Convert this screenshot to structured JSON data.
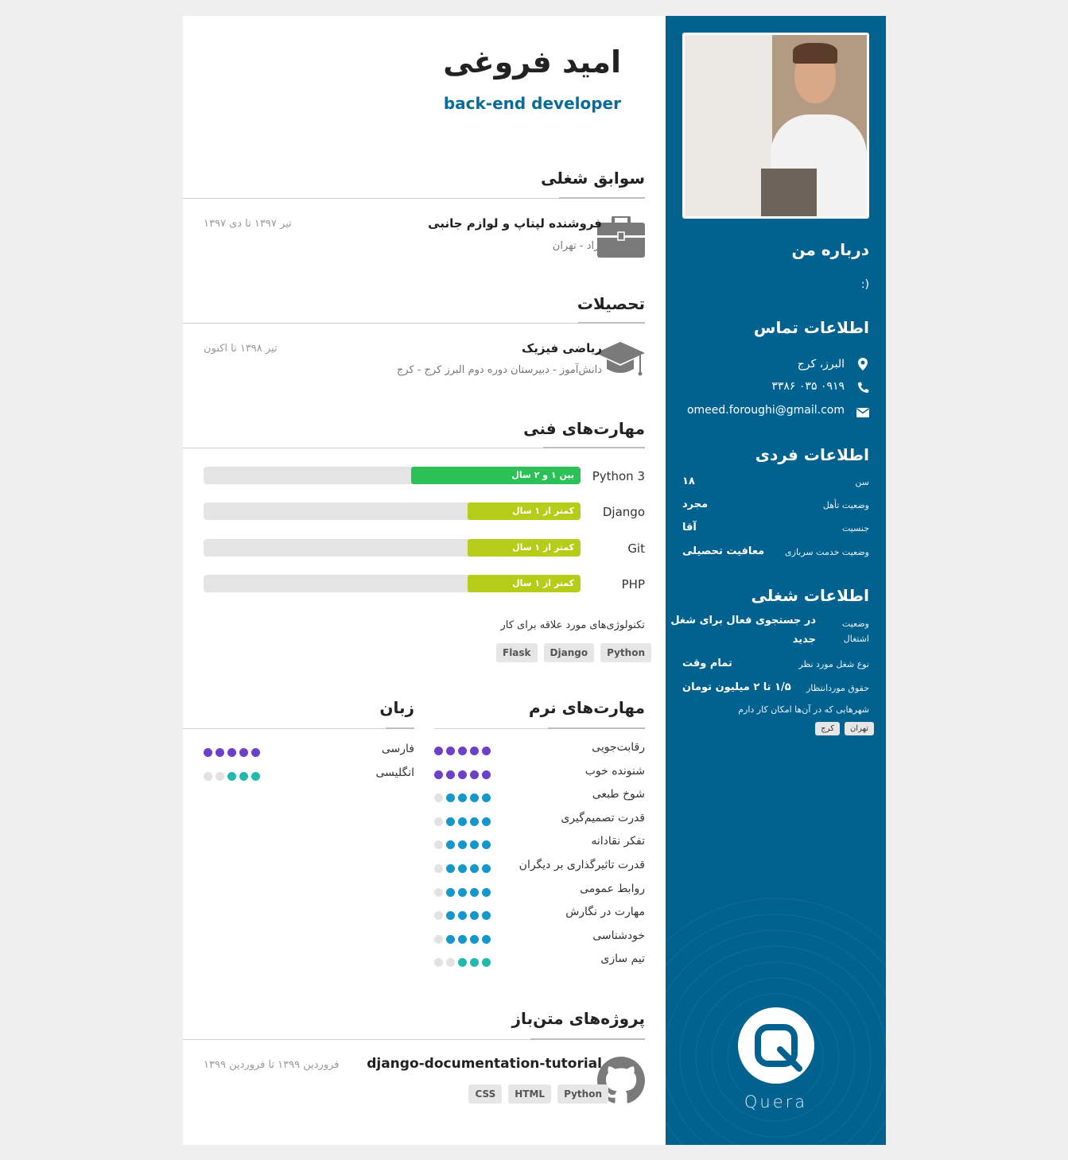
{
  "header": {
    "name": "امید فروغی",
    "role": "back-end developer"
  },
  "work": {
    "title": "سوابق شغلی",
    "items": [
      {
        "title": "فروشنده لپتاپ و لوازم جانبی",
        "sub": "آزاد - تهران",
        "date": "تیر ۱۳۹۷ تا دی ۱۳۹۷",
        "icon": "briefcase-icon"
      }
    ]
  },
  "education": {
    "title": "تحصیلات",
    "items": [
      {
        "title": "ریاضی فیزیک",
        "sub": "دانش‌آموز - دبیرستان دوره دوم البرز کرج - کرج",
        "date": "تیر ۱۳۹۸ تا اکنون",
        "icon": "graduation-cap-icon"
      }
    ]
  },
  "tech_skills": {
    "title": "مهارت‌های فنی",
    "skills": [
      {
        "name": "Python 3",
        "level": "بین ۱ و ۲ سال",
        "fraction": 0.45,
        "color": "#2bc157"
      },
      {
        "name": "Django",
        "level": "کمتر از ۱ سال",
        "fraction": 0.3,
        "color": "#b5cc18"
      },
      {
        "name": "Git",
        "level": "کمتر از ۱ سال",
        "fraction": 0.3,
        "color": "#b5cc18"
      },
      {
        "name": "PHP",
        "level": "کمتر از ۱ سال",
        "fraction": 0.3,
        "color": "#b5cc18"
      }
    ],
    "interest_label": "تکنولوژی‌های مورد علاقه برای کار",
    "interest_tags": [
      "Python",
      "Django",
      "Flask"
    ]
  },
  "soft_skills": {
    "title": "مهارت‌های نرم",
    "items": [
      {
        "label": "رقابت‌جویی",
        "level": 5
      },
      {
        "label": "شنونده خوب",
        "level": 5
      },
      {
        "label": "شوخ طبعی",
        "level": 4
      },
      {
        "label": "قدرت تصمیم‌گیری",
        "level": 4
      },
      {
        "label": "تفکر نقادانه",
        "level": 4
      },
      {
        "label": "قدرت تاثیرگذاری بر دیگران",
        "level": 4
      },
      {
        "label": "روابط عمومی",
        "level": 4
      },
      {
        "label": "مهارت در نگارش",
        "level": 4
      },
      {
        "label": "خودشناسی",
        "level": 4
      },
      {
        "label": "تیم سازی",
        "level": 3
      }
    ]
  },
  "languages": {
    "title": "زبان",
    "items": [
      {
        "label": "فارسی",
        "level": 5
      },
      {
        "label": "انگلیسی",
        "level": 3
      }
    ]
  },
  "projects": {
    "title": "پروژه‌های متن‌باز",
    "items": [
      {
        "title": "django-documentation-tutorial",
        "date": "فروردین ۱۳۹۹ تا فروردین ۱۳۹۹",
        "tags": [
          "Python",
          "HTML",
          "CSS"
        ],
        "icon": "github-icon"
      }
    ]
  },
  "colors": {
    "sidebar": "#02628f",
    "dot_purple": "#6e3fc8",
    "dot_blue": "#1597cc",
    "dot_teal": "#22b8b0",
    "bar_green": "#2bc157",
    "bar_lime": "#b5cc18"
  },
  "sidebar": {
    "about_title": "درباره من",
    "about_text": ":)",
    "contact_title": "اطلاعات تماس",
    "contact": {
      "location": "البرز، کرج",
      "phone": "۰۹۱۹ ۰۳۵ ۳۳۸۶",
      "email": "omeed.foroughi@gmail.com"
    },
    "personal_title": "اطلاعات فردی",
    "personal": [
      {
        "key": "سن",
        "value": "۱۸"
      },
      {
        "key": "وضعیت تأهل",
        "value": "مجرد"
      },
      {
        "key": "جنسیت",
        "value": "آقا"
      },
      {
        "key": "وضعیت خدمت سربازی",
        "value": "معافیت تحصیلی"
      }
    ],
    "job_title": "اطلاعات شغلی",
    "job": {
      "status_key_1": "وضعیت",
      "status_key_2": "اشتغال",
      "status_value_1": "در جستجوی فعال برای شغل",
      "status_value_2": "جدید",
      "type_key": "نوع شغل مورد نظر",
      "type_value": "تمام وقت",
      "salary_key": "حقوق موردانتظار",
      "salary_value": "۱/۵ تا ۲ میلیون تومان",
      "cities_key": "شهرهایی که در آن‌ها امکان کار دارم",
      "cities": [
        "تهران",
        "کرج"
      ]
    },
    "brand": "Quera"
  }
}
